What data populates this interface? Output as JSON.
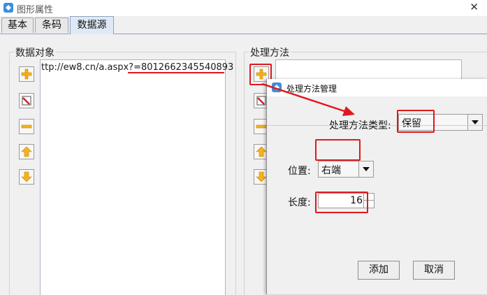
{
  "window": {
    "title": "图形属性"
  },
  "tabs": [
    "基本",
    "条码",
    "数据源"
  ],
  "left_group": {
    "label": "数据对象",
    "items": [
      "ttp://ew8.cn/a.aspx?=8012662345540893"
    ]
  },
  "right_group": {
    "label": "处理方法"
  },
  "dialog": {
    "title": "处理方法管理",
    "method_type_label": "处理方法类型:",
    "method_type_value": "保留",
    "position_label": "位置:",
    "position_value": "右端",
    "length_label": "长度:",
    "length_value": "16",
    "add_button": "添加",
    "cancel_button": "取消"
  },
  "colors": {
    "highlight": "#e0181e",
    "icon_yellow": "#f6b21a"
  }
}
